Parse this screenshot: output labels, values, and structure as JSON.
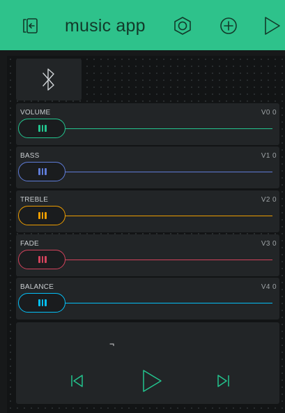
{
  "header": {
    "title": "music app"
  },
  "colors": {
    "header_bg": "#2ec28b",
    "volume": "#23c48e",
    "bass": "#5f7cd8",
    "treble": "#ed9d00",
    "fade": "#d3435c",
    "balance": "#04c0f8",
    "player_accent": "#23c48e"
  },
  "icons": {
    "exit": "exit-icon",
    "settings": "hexagon-nut-icon",
    "add": "plus-circle-icon",
    "play": "play-icon",
    "bluetooth": "bluetooth-icon",
    "prev": "skip-previous-icon",
    "next": "skip-next-icon"
  },
  "sliders": [
    {
      "label": "VOLUME",
      "pin": "V0 0"
    },
    {
      "label": "BASS",
      "pin": "V1 0"
    },
    {
      "label": "TREBLE",
      "pin": "V2 0"
    },
    {
      "label": "FADE",
      "pin": "V3 0"
    },
    {
      "label": "BALANCE",
      "pin": "V4 0"
    }
  ],
  "player": {
    "track": "¬"
  }
}
